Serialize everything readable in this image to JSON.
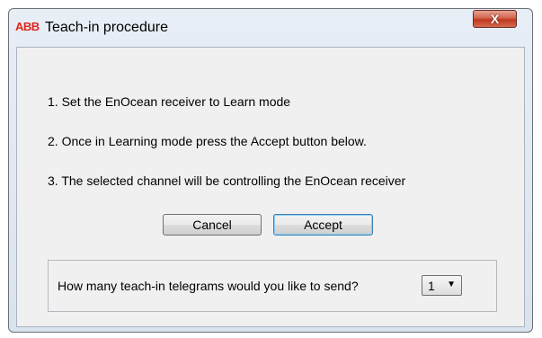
{
  "window": {
    "logo": "ABB",
    "title": "Teach-in procedure",
    "close_glyph": "X"
  },
  "steps": [
    "1. Set the EnOcean receiver to Learn mode",
    "2. Once in Learning mode press the Accept button below.",
    "3. The selected channel will be controlling the EnOcean receiver"
  ],
  "buttons": {
    "cancel": "Cancel",
    "accept": "Accept"
  },
  "telegrams": {
    "question": "How many teach-in telegrams would you like to send?",
    "selected_value": "1",
    "arrow_icon": "▼"
  }
}
